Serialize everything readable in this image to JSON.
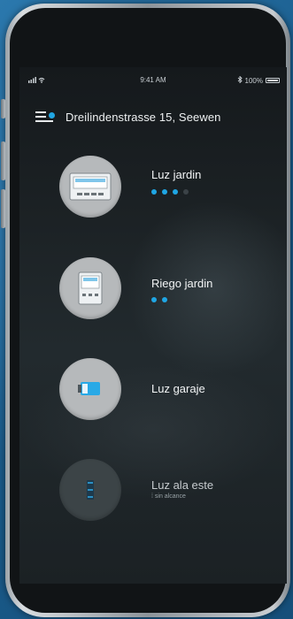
{
  "status_bar": {
    "time": "9:41 AM",
    "battery_text": "100%",
    "battery_level": 1.0
  },
  "header": {
    "title": "Dreilindenstrasse 15, Seewen",
    "menu_icon": "menu-with-notification-dot-icon"
  },
  "devices": [
    {
      "name": "Luz jardin",
      "icon": "timer-panel-icon",
      "signal_level": 3,
      "signal_max": 4,
      "subtitle": ""
    },
    {
      "name": "Riego jardin",
      "icon": "irrigation-controller-icon",
      "signal_level": 2,
      "signal_max": 2,
      "subtitle": ""
    },
    {
      "name": "Luz garaje",
      "icon": "switch-module-icon",
      "signal_level": 0,
      "signal_max": 0,
      "subtitle": ""
    },
    {
      "name": "Luz ala este",
      "icon": "dimmer-switch-icon",
      "signal_level": 0,
      "signal_max": 0,
      "subtitle": "sin alcance"
    }
  ],
  "colors": {
    "accent": "#1fa6e4",
    "background": "#1d5f8d",
    "screen": "#1c2225"
  }
}
